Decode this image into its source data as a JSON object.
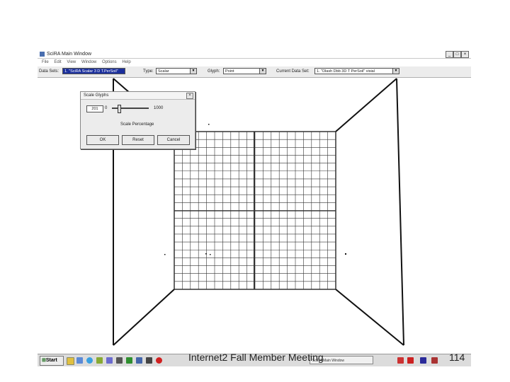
{
  "window": {
    "title": "SciRA Main Window",
    "minimize_label": "_",
    "maximize_label": "□",
    "close_label": "×",
    "menus": [
      "File",
      "Edit",
      "View",
      "Window",
      "Options",
      "Help"
    ]
  },
  "toolbar": {
    "data_sets_label": "Data Sets:",
    "data_sets_value": "1. \"SciRA Scalar 3 D T.PerSoil\"",
    "type_label": "Type:",
    "type_value": "Scalar",
    "glyph_label": "Glyph:",
    "glyph_value": "Point",
    "current_label": "Current Data Set:",
    "current_value": "1. \"Dlash Dbb 3D T PerSoil\" visial"
  },
  "dialog": {
    "title": "Scale Glyphs",
    "value_box": "201",
    "slider_min": "0",
    "slider_max": "1000",
    "slider_value": 0.2,
    "caption": "Scale Percentage",
    "ok_label": "OK",
    "reset_label": "Reset",
    "cancel_label": "Cancel"
  },
  "taskbar": {
    "start_label": "Start",
    "task_label": "SciRA Main Window"
  },
  "footer": {
    "meeting": "Internet2 Fall Member Meeting",
    "page_number": "114"
  },
  "colors": {
    "selection": "#1b2f9c",
    "chrome": "#ececec",
    "grid": "#333333"
  }
}
